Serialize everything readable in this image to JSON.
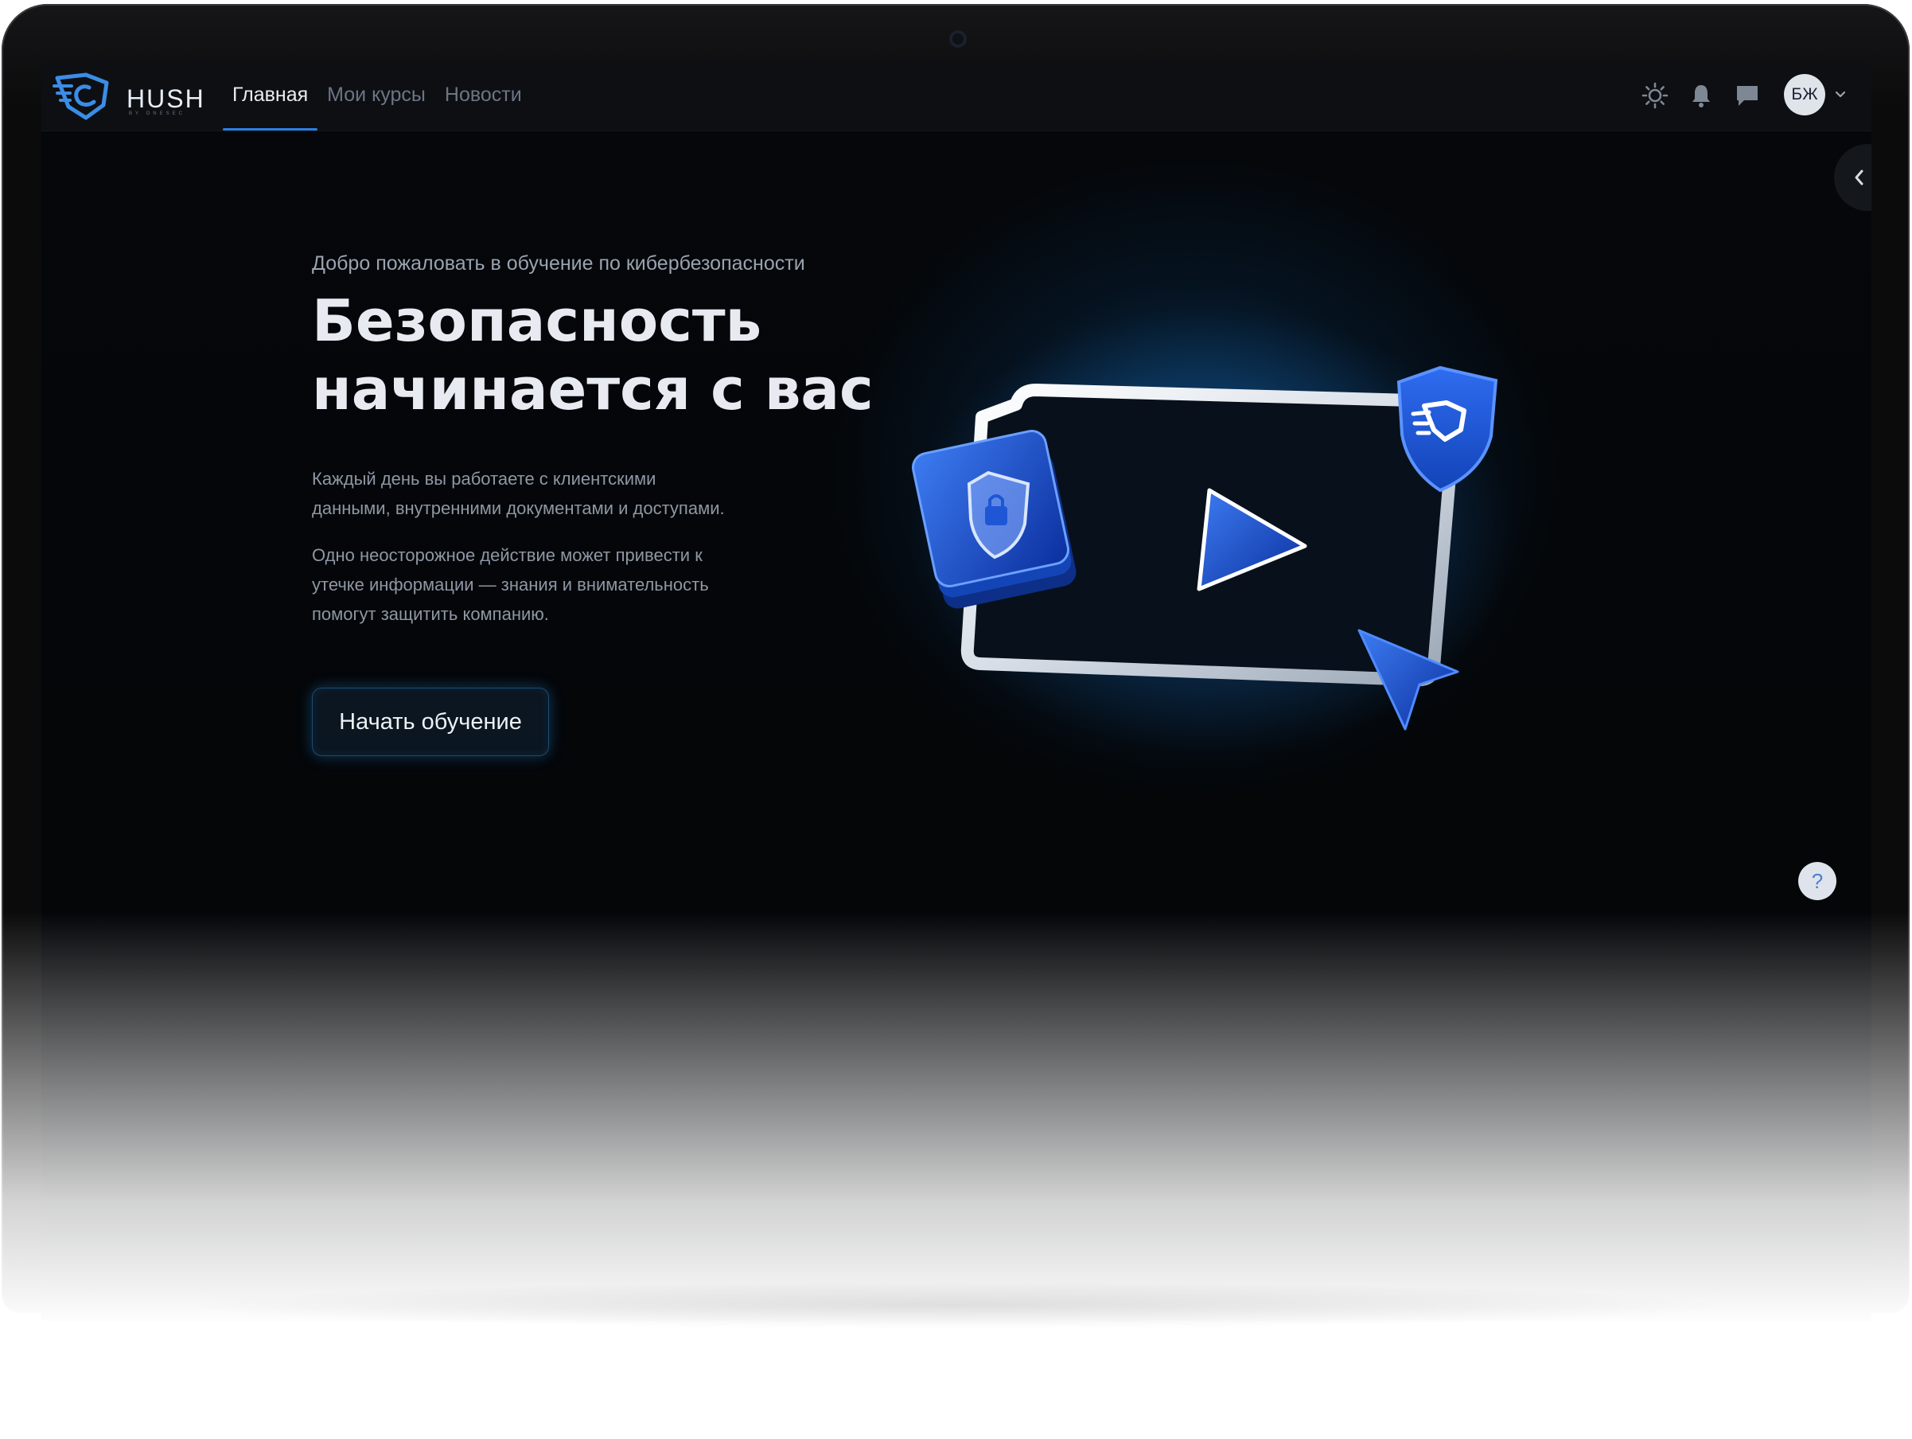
{
  "brand": {
    "name": "HUSH",
    "tagline": "BY ONESEC",
    "accent": "#2b7fe0"
  },
  "nav": {
    "items": [
      {
        "label": "Главная",
        "active": true
      },
      {
        "label": "Мои курсы",
        "active": false
      },
      {
        "label": "Новости",
        "active": false
      }
    ]
  },
  "toolbar": {
    "icons": [
      "sun-icon",
      "bell-icon",
      "chat-icon"
    ],
    "avatar_initials": "БЖ",
    "avatar_menu_icon": "chevron-down-icon"
  },
  "sidebar_toggle": {
    "icon": "chevron-left-icon"
  },
  "hero": {
    "eyebrow": "Добро пожаловать в обучение по кибербезопасности",
    "headline_line1": "Безопасность",
    "headline_line2": "начинается с вас",
    "paragraph1_line1": "Каждый день вы работаете с клиентскими",
    "paragraph1_line2": "данными, внутренними документами и доступами.",
    "paragraph2_line1": "Одно неосторожное действие может привести к",
    "paragraph2_line2": "утечке информации — знания и внимательность",
    "paragraph2_line3": "помогут защитить компанию.",
    "cta_label": "Начать обучение"
  },
  "illustration": {
    "icons": [
      "video-frame-icon",
      "play-icon",
      "shield-lock-icon",
      "shield-logo-icon",
      "cursor-arrow-icon"
    ]
  },
  "help": {
    "label": "?"
  }
}
